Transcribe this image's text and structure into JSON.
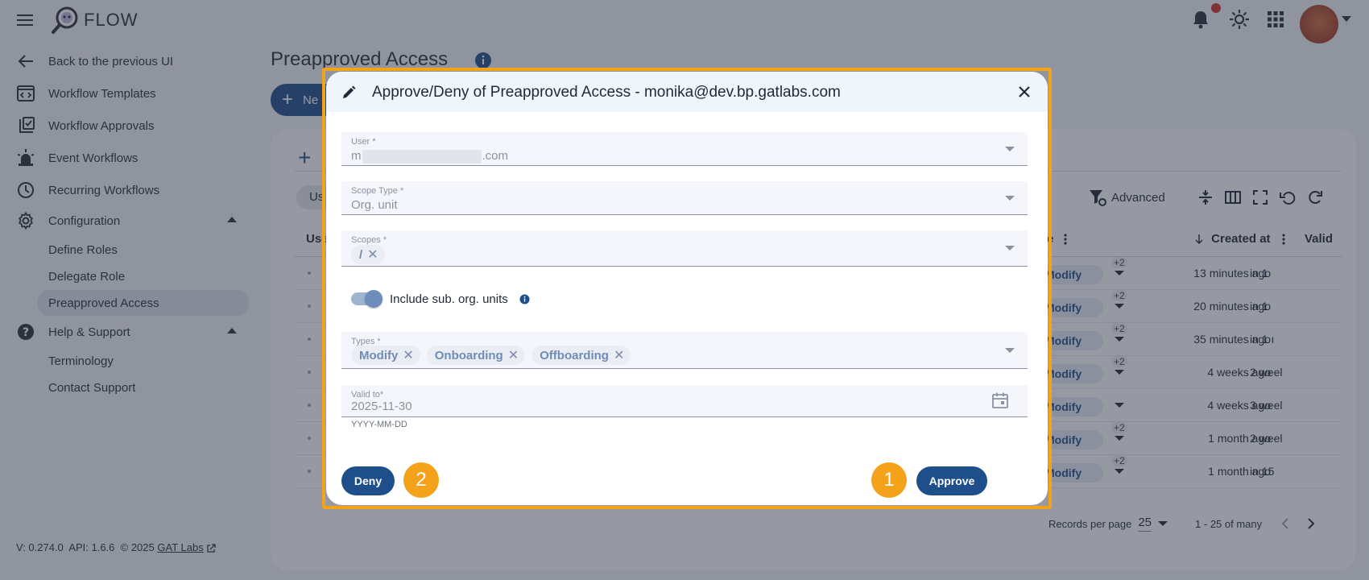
{
  "app": {
    "name": "FLOW"
  },
  "sidebar": {
    "items": [
      {
        "label": "Back to the previous UI",
        "icon": "arrow-left-icon"
      },
      {
        "label": "Workflow Templates",
        "icon": "code-window-icon"
      },
      {
        "label": "Workflow Approvals",
        "icon": "checklist-icon"
      },
      {
        "label": "Event Workflows",
        "icon": "siren-icon"
      },
      {
        "label": "Recurring Workflows",
        "icon": "clock-icon"
      },
      {
        "label": "Configuration",
        "icon": "gear-icon"
      },
      {
        "label": "Help & Support",
        "icon": "help-icon"
      }
    ],
    "config_sub": [
      "Define Roles",
      "Delegate Role",
      "Preapproved Access"
    ],
    "help_sub": [
      "Terminology",
      "Contact Support"
    ]
  },
  "footer": {
    "version": "V: 0.274.0",
    "api": "API: 1.6.6",
    "copyright": "© 2025",
    "company": "GAT Labs"
  },
  "page": {
    "title": "Preapproved Access",
    "new_button": "Ne",
    "chip": "Us",
    "advanced": "Advanced",
    "columns": {
      "user": "Use",
      "type": "e",
      "created": "Created at",
      "valid": "Valid"
    },
    "rows": [
      {
        "type": "Modify",
        "more": "+2",
        "created": "13 minutes ago",
        "valid": "in 1"
      },
      {
        "type": "Modify",
        "more": "+2",
        "created": "20 minutes ago",
        "valid": "in 1"
      },
      {
        "type": "Modify",
        "more": "+2",
        "created": "35 minutes ago",
        "valid": "in 1 ı"
      },
      {
        "type": "Modify",
        "more": "+2",
        "created": "4 weeks ago",
        "valid": "2 weel"
      },
      {
        "type": "Modify",
        "more": "",
        "created": "4 weeks ago",
        "valid": "3 weel"
      },
      {
        "type": "Modify",
        "more": "+2",
        "created": "1 month ago",
        "valid": "2 weel"
      },
      {
        "type": "Modify",
        "more": "+2",
        "created": "1 month ago",
        "valid": "in 15"
      }
    ],
    "pager": {
      "label": "Records per page",
      "per_page": "25",
      "range": "1 - 25 of many"
    }
  },
  "dialog": {
    "title": "Approve/Deny of Preapproved Access - monika@dev.bp.gatlabs.com",
    "user": {
      "label": "User *",
      "prefix": "m",
      "suffix": ".com"
    },
    "scope_type": {
      "label": "Scope Type *",
      "value": "Org. unit"
    },
    "scopes": {
      "label": "Scopes *",
      "chips": [
        "/"
      ]
    },
    "include_sub": {
      "label": "Include sub. org. units",
      "on": true
    },
    "types": {
      "label": "Types *",
      "chips": [
        "Modify",
        "Onboarding",
        "Offboarding"
      ]
    },
    "valid_to": {
      "label": "Valid to*",
      "value": "2025-11-30",
      "helper": "YYYY-MM-DD"
    },
    "deny_label": "Deny",
    "approve_label": "Approve",
    "badges": {
      "deny": "2",
      "approve": "1"
    }
  },
  "colors": {
    "primary": "#1e4f8a",
    "highlight": "#f5a21b",
    "notification": "#d32f2f"
  }
}
